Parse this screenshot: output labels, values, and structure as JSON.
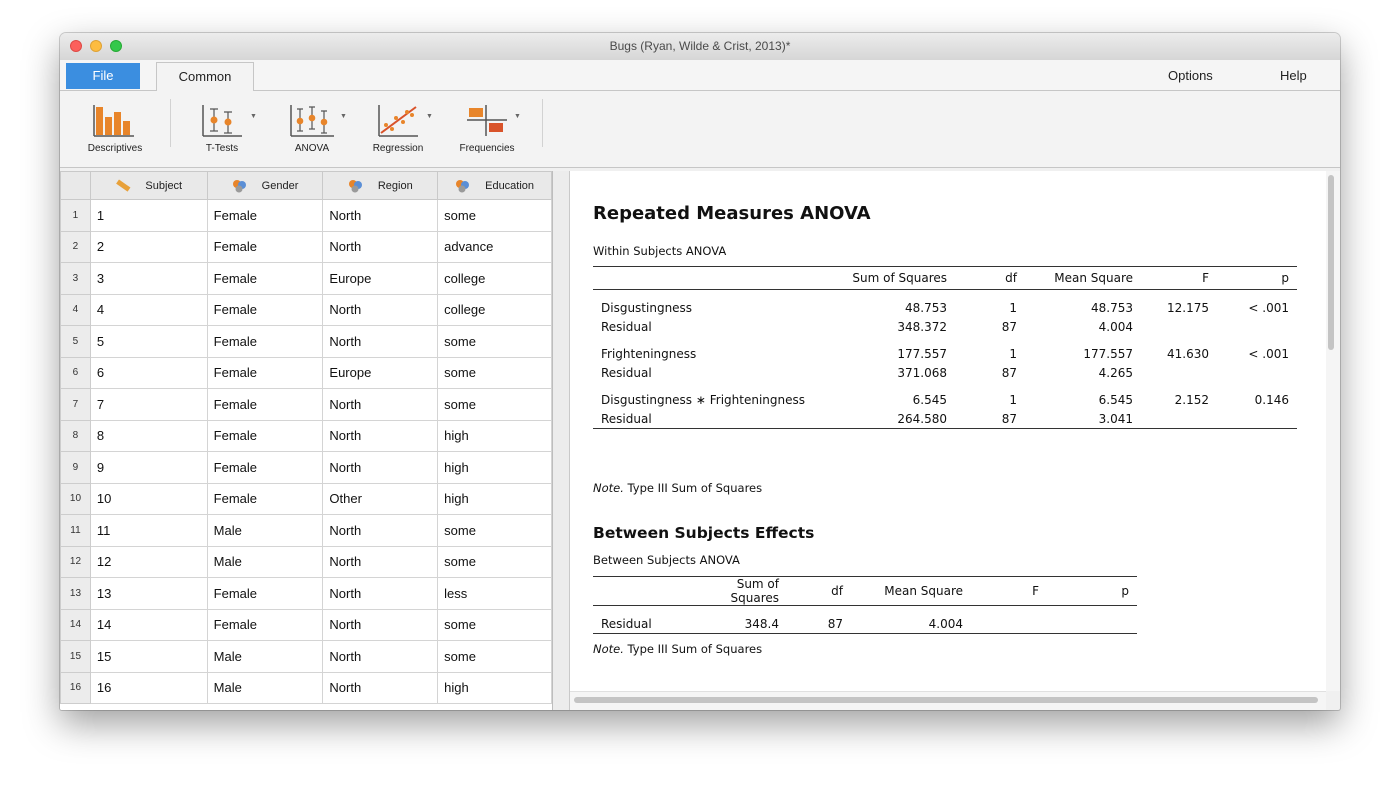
{
  "window": {
    "title": "Bugs (Ryan, Wilde & Crist, 2013)*"
  },
  "menu": {
    "file": "File",
    "common": "Common",
    "options": "Options",
    "help": "Help"
  },
  "toolbar": [
    {
      "label": "Descriptives",
      "icon": "bar-chart-icon",
      "dropdown": false
    },
    {
      "label": "T-Tests",
      "icon": "ttest-icon",
      "dropdown": true
    },
    {
      "label": "ANOVA",
      "icon": "anova-icon",
      "dropdown": true
    },
    {
      "label": "Regression",
      "icon": "regression-icon",
      "dropdown": true
    },
    {
      "label": "Frequencies",
      "icon": "frequencies-icon",
      "dropdown": true
    }
  ],
  "grid": {
    "columns": [
      {
        "name": "Subject",
        "type": "scale",
        "icon": "ruler-icon"
      },
      {
        "name": "Gender",
        "type": "nominal",
        "icon": "nominal-icon"
      },
      {
        "name": "Region",
        "type": "nominal",
        "icon": "nominal-icon"
      },
      {
        "name": "Education",
        "type": "nominal",
        "icon": "nominal-icon"
      }
    ],
    "rows": [
      [
        "1",
        "1",
        "Female",
        "North",
        "some"
      ],
      [
        "2",
        "2",
        "Female",
        "North",
        "advance"
      ],
      [
        "3",
        "3",
        "Female",
        "Europe",
        "college"
      ],
      [
        "4",
        "4",
        "Female",
        "North",
        "college"
      ],
      [
        "5",
        "5",
        "Female",
        "North",
        "some"
      ],
      [
        "6",
        "6",
        "Female",
        "Europe",
        "some"
      ],
      [
        "7",
        "7",
        "Female",
        "North",
        "some"
      ],
      [
        "8",
        "8",
        "Female",
        "North",
        "high"
      ],
      [
        "9",
        "9",
        "Female",
        "North",
        "high"
      ],
      [
        "10",
        "10",
        "Female",
        "Other",
        "high"
      ],
      [
        "11",
        "11",
        "Male",
        "North",
        "some"
      ],
      [
        "12",
        "12",
        "Male",
        "North",
        "some"
      ],
      [
        "13",
        "13",
        "Female",
        "North",
        "less"
      ],
      [
        "14",
        "14",
        "Female",
        "North",
        "some"
      ],
      [
        "15",
        "15",
        "Male",
        "North",
        "some"
      ],
      [
        "16",
        "16",
        "Male",
        "North",
        "high"
      ]
    ]
  },
  "results": {
    "title": "Repeated Measures ANOVA",
    "within": {
      "subtitle": "Within Subjects ANOVA",
      "headers": [
        "",
        "Sum of Squares",
        "df",
        "Mean Square",
        "F",
        "p"
      ],
      "groups": [
        [
          [
            "Disgustingness",
            "48.753",
            "1",
            "48.753",
            "12.175",
            "< .001"
          ],
          [
            "Residual",
            "348.372",
            "87",
            "4.004",
            "",
            ""
          ]
        ],
        [
          [
            "Frighteningness",
            "177.557",
            "1",
            "177.557",
            "41.630",
            "< .001"
          ],
          [
            "Residual",
            "371.068",
            "87",
            "4.265",
            "",
            ""
          ]
        ],
        [
          [
            "Disgustingness ∗ Frighteningness",
            "6.545",
            "1",
            "6.545",
            "2.152",
            "0.146"
          ],
          [
            "Residual",
            "264.580",
            "87",
            "3.041",
            "",
            ""
          ]
        ]
      ],
      "note_label": "Note.",
      "note_text": " Type III Sum of Squares"
    },
    "between": {
      "title": "Between Subjects Effects",
      "subtitle": "Between Subjects ANOVA",
      "headers": [
        "",
        "Sum of Squares",
        "df",
        "Mean Square",
        "F",
        "p"
      ],
      "rows": [
        [
          "Residual",
          "348.4",
          "87",
          "4.004",
          "",
          ""
        ]
      ],
      "note_label": "Note.",
      "note_text": " Type III Sum of Squares"
    }
  },
  "colors": {
    "file_tab": "#3b8ee0",
    "icon_orange": "#e8852a",
    "icon_red": "#d9532a"
  }
}
